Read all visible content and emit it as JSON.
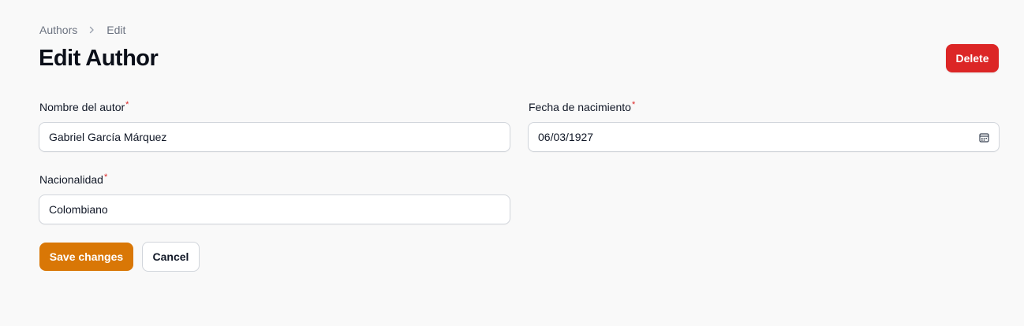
{
  "breadcrumb": {
    "items": [
      "Authors",
      "Edit"
    ],
    "separator_icon": "chevron-right-icon"
  },
  "header": {
    "title": "Edit Author",
    "delete_label": "Delete"
  },
  "form": {
    "required_marker": "*",
    "nombre": {
      "label": "Nombre del autor",
      "value": "Gabriel García Márquez"
    },
    "fecha": {
      "label": "Fecha de nacimiento",
      "value": "06/03/1927",
      "icon": "calendar-icon"
    },
    "nacionalidad": {
      "label": "Nacionalidad",
      "value": "Colombiano"
    }
  },
  "actions": {
    "save_label": "Save changes",
    "cancel_label": "Cancel"
  },
  "colors": {
    "primary": "#d97706",
    "danger": "#dc2626",
    "background": "#f9f9f9"
  }
}
